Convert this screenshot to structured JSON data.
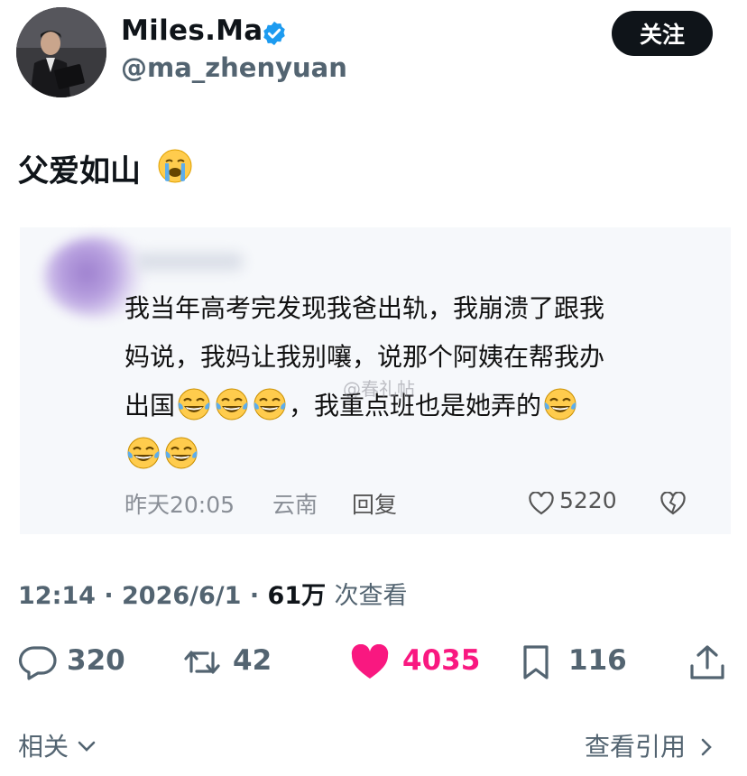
{
  "author": {
    "display_name": "Miles.Ma",
    "handle": "@ma_zhenyuan",
    "verified_color": "#1d9bf0"
  },
  "follow_label": "关注",
  "tweet": {
    "text": "父爱如山",
    "emoji": "loudly-crying-face"
  },
  "embedded_comment": {
    "text_line1": "我当年高考完发现我爸出轨，我崩溃了跟我",
    "text_line2": "妈说，我妈让我别嚷，说那个阿姨在帮我办",
    "text_line3a": "出国",
    "text_line3b": "，我重点班也是她弄的",
    "emoji": "face-with-tears-of-joy",
    "watermark": "@春礼帖",
    "time": "昨天20:05",
    "location": "云南",
    "reply_label": "回复",
    "likes": "5220"
  },
  "stats": {
    "time": "12:14",
    "date": "2026/6/1",
    "views": "61万",
    "views_label": "次查看"
  },
  "actions": {
    "replies": "320",
    "retweets": "42",
    "likes": "4035",
    "bookmarks": "116",
    "like_color": "#f91880"
  },
  "footer": {
    "related": "相关",
    "view_quotes": "查看引用"
  }
}
